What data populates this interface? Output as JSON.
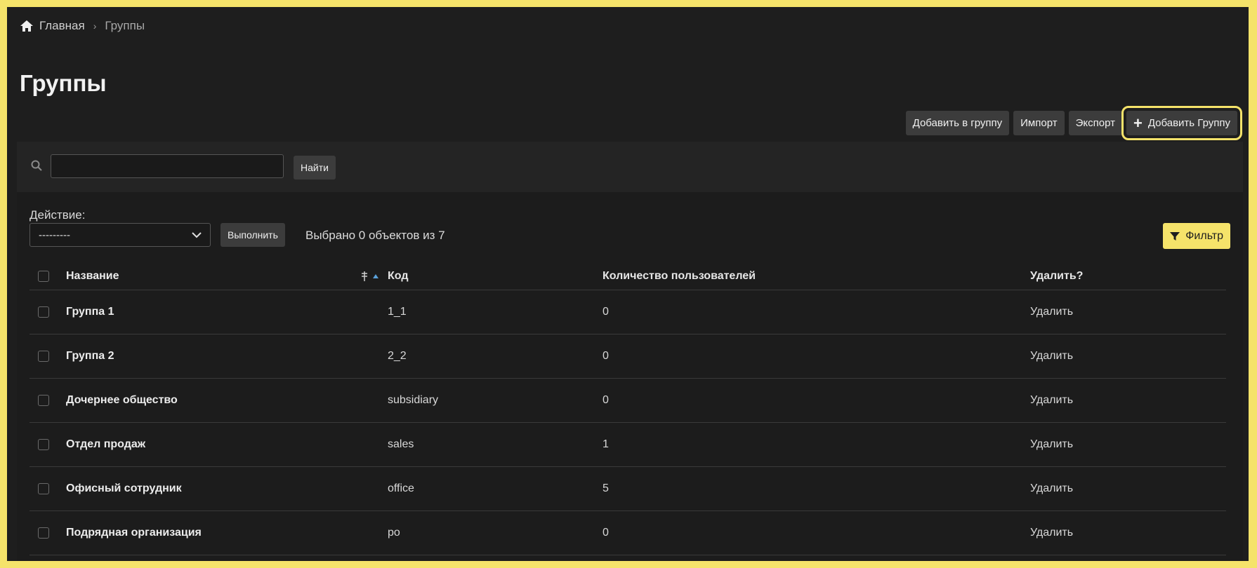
{
  "breadcrumb": {
    "home": "Главная",
    "separator": "›",
    "current": "Группы"
  },
  "page_title": "Группы",
  "toolbar": {
    "add_to_group": "Добавить в группу",
    "import": "Импорт",
    "export": "Экспорт",
    "add_group_plus": "+",
    "add_group": "Добавить Группу"
  },
  "search": {
    "value": "",
    "button": "Найти"
  },
  "actions": {
    "label": "Действие:",
    "select_value": "---------",
    "run": "Выполнить",
    "selected": "Выбрано 0 объектов из 7",
    "filter": "Фильтр"
  },
  "table": {
    "headers": {
      "name": "Название",
      "code": "Код",
      "users": "Количество пользователей",
      "delete": "Удалить?"
    },
    "rows": [
      {
        "name": "Группа 1",
        "code": "1_1",
        "users": "0",
        "delete": "Удалить"
      },
      {
        "name": "Группа 2",
        "code": "2_2",
        "users": "0",
        "delete": "Удалить"
      },
      {
        "name": "Дочернее общество",
        "code": "subsidiary",
        "users": "0",
        "delete": "Удалить"
      },
      {
        "name": "Отдел продаж",
        "code": "sales",
        "users": "1",
        "delete": "Удалить"
      },
      {
        "name": "Офисный сотрудник",
        "code": "office",
        "users": "5",
        "delete": "Удалить"
      },
      {
        "name": "Подрядная организация",
        "code": "po",
        "users": "0",
        "delete": "Удалить"
      }
    ]
  },
  "colors": {
    "accent": "#f5e36a",
    "background": "#1e1e1e",
    "annotation_arrow": "#e0305a"
  }
}
